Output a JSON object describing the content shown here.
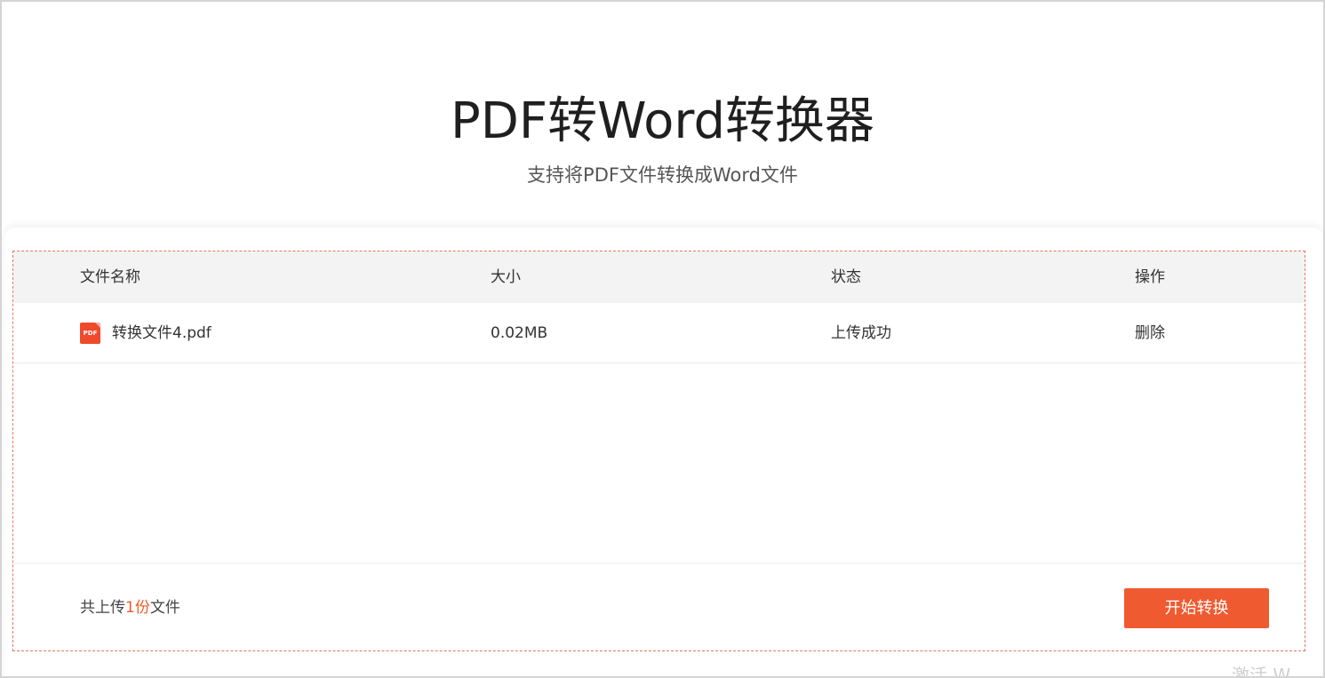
{
  "header": {
    "title": "PDF转Word转换器",
    "subtitle": "支持将PDF文件转换成Word文件"
  },
  "table": {
    "columns": [
      "文件名称",
      "大小",
      "状态",
      "操作"
    ],
    "rows": [
      {
        "icon": "pdf-file-icon",
        "icon_label": "PDF",
        "name": "转换文件4.pdf",
        "size": "0.02MB",
        "status": "上传成功",
        "action": "删除"
      }
    ]
  },
  "footer": {
    "count_prefix": "共上传",
    "count_value": "1份",
    "count_suffix": "文件",
    "start_button": "开始转换"
  },
  "watermark": "激活 W",
  "colors": {
    "accent": "#f05a30",
    "pdf_icon": "#ef4a2b",
    "dashed_border": "#e07a5f",
    "header_row": "#f3f3f3"
  }
}
